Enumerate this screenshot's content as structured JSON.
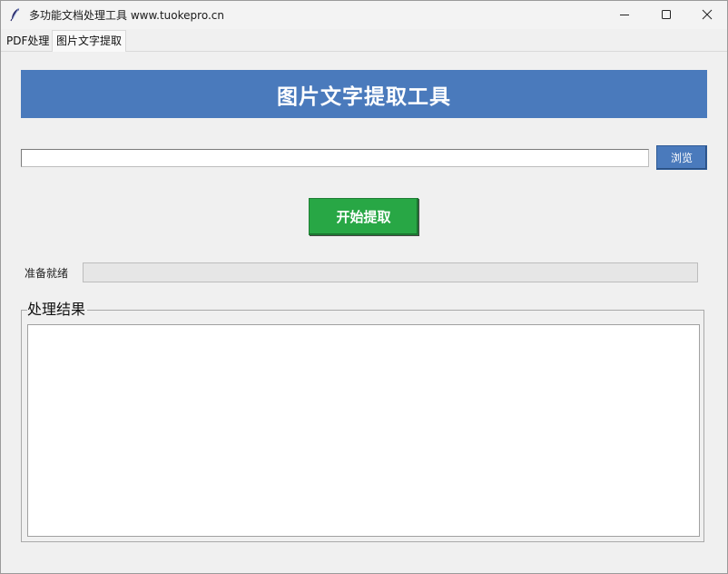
{
  "window": {
    "title": "多功能文档处理工具 www.tuokepro.cn",
    "icon": "feather-icon",
    "controls": {
      "minimize_icon": "minimize-icon",
      "maximize_icon": "maximize-icon",
      "close_icon": "close-icon"
    }
  },
  "tabs": [
    {
      "label": "PDF处理",
      "selected": false
    },
    {
      "label": "图片文字提取",
      "selected": true
    }
  ],
  "header": {
    "title": "图片文字提取工具",
    "color": "#4a7abc"
  },
  "file_select": {
    "path_value": "",
    "browse_label": "浏览",
    "browse_color": "#4a7abc"
  },
  "actions": {
    "start_label": "开始提取",
    "start_color": "#28a745"
  },
  "status": {
    "text": "准备就绪",
    "progress": 0
  },
  "result": {
    "group_label": "处理结果",
    "text": ""
  }
}
